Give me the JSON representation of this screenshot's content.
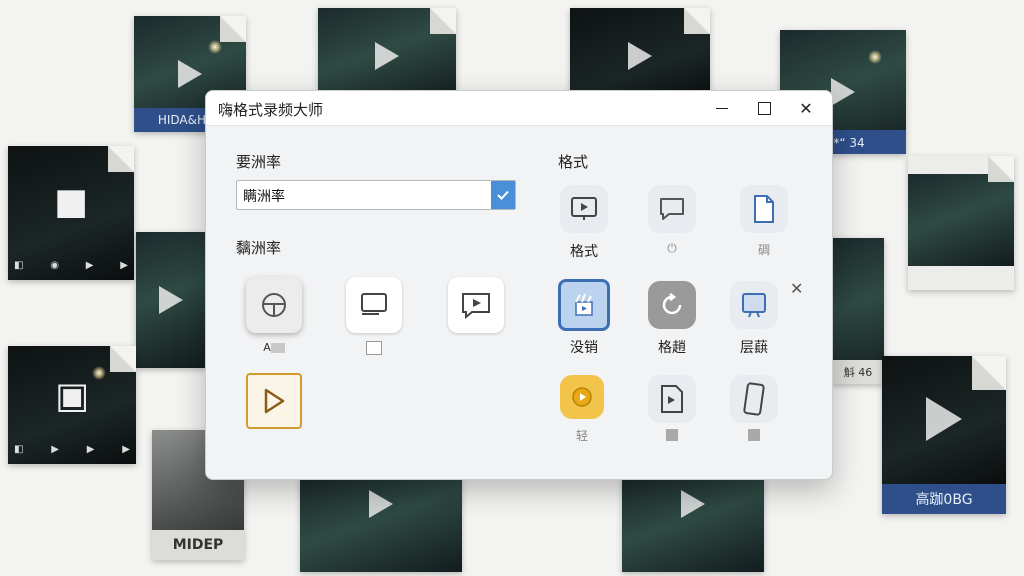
{
  "window": {
    "title": "嗨格式录频大师"
  },
  "left": {
    "resolution_label": "要洲率",
    "resolution_select_value": "瞒洲率",
    "source_label": "黐洲率",
    "source_items": [
      {
        "name": "steering-wheel",
        "caption": "A"
      },
      {
        "name": "monitor",
        "caption": ""
      },
      {
        "name": "screen-record",
        "caption": ""
      },
      {
        "name": "play",
        "caption": ""
      }
    ]
  },
  "right": {
    "format_label": "格式",
    "formats": [
      {
        "icon": "slideshow-icon",
        "label": "格式"
      },
      {
        "icon": "chat-bubble-icon",
        "label": ""
      },
      {
        "icon": "document-icon",
        "label": "碉"
      },
      {
        "icon": "clapperboard-icon",
        "label": "没销"
      },
      {
        "icon": "refresh-icon",
        "label": "格趙"
      },
      {
        "icon": "presentation-icon",
        "label": "层蕻"
      },
      {
        "icon": "yellow-media-icon",
        "label": "轻"
      },
      {
        "icon": "video-file-icon",
        "label": ""
      },
      {
        "icon": "phone-icon",
        "label": ""
      }
    ]
  },
  "background_tiles": {
    "tile_a_caption": "HIDA&HOL",
    "tile_b_caption": "稿*“ 34",
    "tile_c_caption": "MIDEP",
    "tile_d_caption": "高跏0BG",
    "tile_e_caption": "斛 46"
  },
  "colors": {
    "accent": "#4a90d9",
    "selected_border": "#3e6fb5",
    "gold_border": "#d19a2e",
    "banner_blue": "#2e4f8a"
  }
}
